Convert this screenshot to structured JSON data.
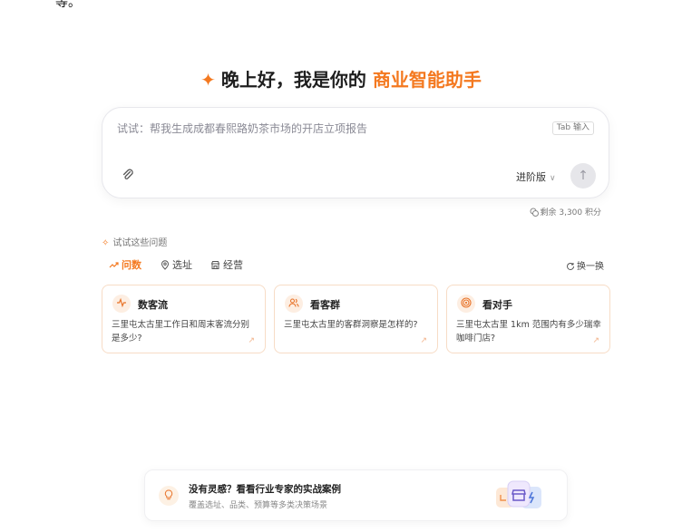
{
  "top_fragment": "等。",
  "greeting": {
    "prefix": "晚上好，我是你的",
    "brand": "商业智能助手"
  },
  "input": {
    "placeholder": "试试：帮我生成成都春熙路奶茶市场的开店立项报告",
    "tab_hint": "Tab 输入",
    "version_label": "进阶版"
  },
  "credits": "剩余 3,300 积分",
  "suggestions": {
    "title": "试试这些问题",
    "refresh_label": "换一换",
    "tabs": [
      {
        "label": "问数",
        "active": true
      },
      {
        "label": "选址",
        "active": false
      },
      {
        "label": "经营",
        "active": false
      }
    ],
    "cards": [
      {
        "title": "数客流",
        "text": "三里屯太古里工作日和周末客流分别是多少?"
      },
      {
        "title": "看客群",
        "text": "三里屯太古里的客群洞察是怎样的?"
      },
      {
        "title": "看对手",
        "text": "三里屯太古里 1km 范围内有多少瑞幸咖啡门店?"
      }
    ]
  },
  "inspiration": {
    "title": "没有灵感？看看行业专家的实战案例",
    "subtitle": "覆盖选址、品类、预算等多类决策场景"
  },
  "colors": {
    "accent": "#f47920",
    "card_border": "#f7dcc6"
  }
}
